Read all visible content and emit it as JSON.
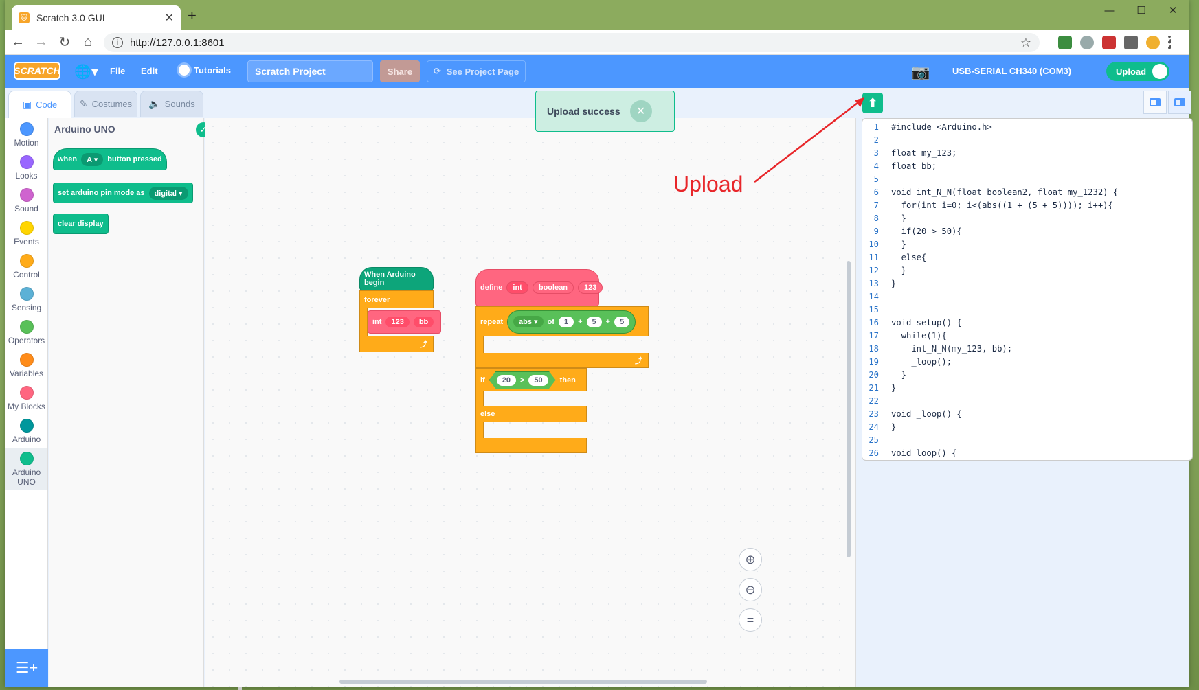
{
  "browser": {
    "tab_title": "Scratch 3.0 GUI",
    "tab_close": "✕",
    "new_tab": "+",
    "url": "http://127.0.0.1:8601"
  },
  "menubar": {
    "logo": "SCRATCH",
    "file": "File",
    "edit": "Edit",
    "tutorials": "Tutorials",
    "project_title": "Scratch Project",
    "share": "Share",
    "see_project_page": "See Project Page",
    "serial_port": "USB-SERIAL CH340 (COM3)",
    "upload_toggle": "Upload"
  },
  "tabs": {
    "code": "Code",
    "costumes": "Costumes",
    "sounds": "Sounds"
  },
  "categories": [
    {
      "label": "Motion",
      "color": "#4c97ff"
    },
    {
      "label": "Looks",
      "color": "#9966ff"
    },
    {
      "label": "Sound",
      "color": "#cf63cf"
    },
    {
      "label": "Events",
      "color": "#ffd500"
    },
    {
      "label": "Control",
      "color": "#ffab19"
    },
    {
      "label": "Sensing",
      "color": "#5cb1d6"
    },
    {
      "label": "Operators",
      "color": "#59c059"
    },
    {
      "label": "Variables",
      "color": "#ff8c1a"
    },
    {
      "label": "My Blocks",
      "color": "#ff6680"
    },
    {
      "label": "Arduino",
      "color": "#00979c"
    },
    {
      "label": "Arduino\nUNO",
      "color": "#0fbd8c"
    }
  ],
  "palette": {
    "heading": "Arduino UNO",
    "block1_when": "when",
    "block1_key": "A",
    "block1_suffix": "button pressed",
    "block2_label": "set arduino pin mode as",
    "block2_value": "digital",
    "block3_label": "clear display"
  },
  "script": {
    "hat": "When Arduino begin",
    "forever": "forever",
    "call_name": "int",
    "call_arg1": "123",
    "call_arg2": "bb",
    "define": "define",
    "def_name": "int",
    "def_param1": "boolean",
    "def_param2": "123",
    "repeat": "repeat",
    "abs": "abs",
    "of": "of",
    "n1": "1",
    "plus": "+",
    "n2": "5",
    "n3": "5",
    "if": "if",
    "cmp_a": "20",
    "gt": ">",
    "cmp_b": "50",
    "then": "then",
    "else": "else"
  },
  "toast": {
    "message": "Upload success",
    "close": "✕"
  },
  "annotation": {
    "label": "Upload"
  },
  "code_lines": [
    "#include <Arduino.h>",
    "",
    "float my_123;",
    "float bb;",
    "",
    "void int_N_N(float boolean2, float my_1232) {",
    "  for(int i=0; i<(abs((1 + (5 + 5)))); i++){",
    "  }",
    "  if(20 > 50){",
    "  }",
    "  else{",
    "  }",
    "}",
    "",
    "",
    "void setup() {",
    "  while(1){",
    "    int_N_N(my_123, bb);",
    "    _loop();",
    "  }",
    "}",
    "",
    "void _loop() {",
    "}",
    "",
    "void loop() {"
  ],
  "line_numbers": [
    "1",
    "2",
    "3",
    "4",
    "5",
    "6",
    "7",
    "8",
    "9",
    "10",
    "11",
    "12",
    "13",
    "14",
    "15",
    "16",
    "17",
    "18",
    "19",
    "20",
    "21",
    "22",
    "23",
    "24",
    "25",
    "26"
  ]
}
